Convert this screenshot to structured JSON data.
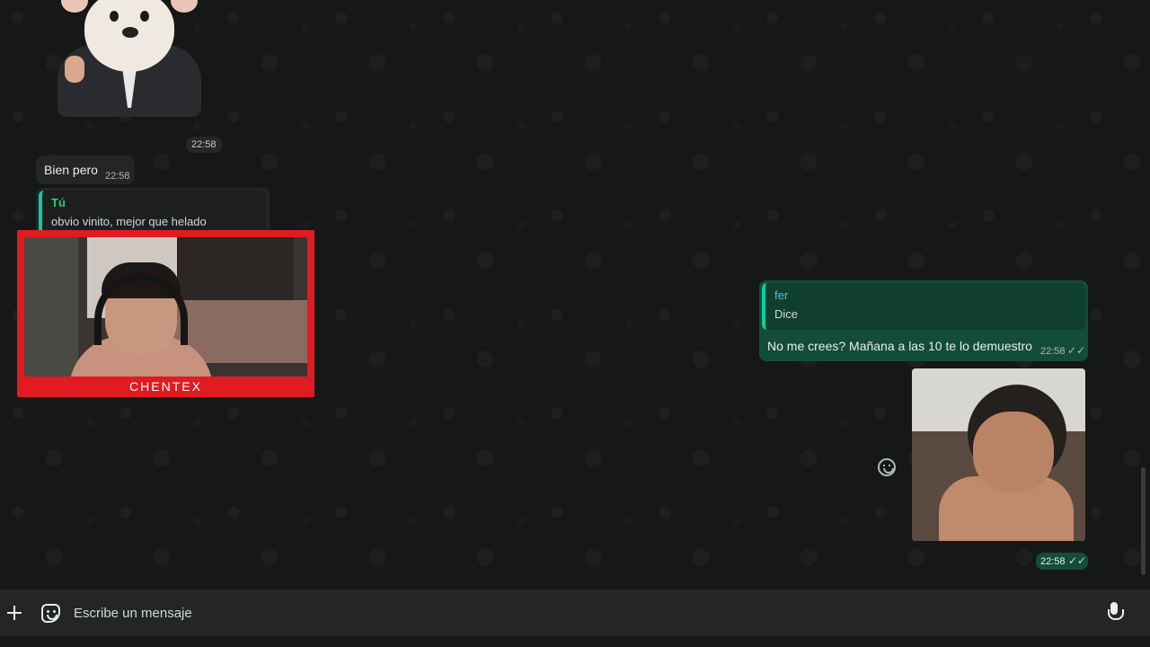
{
  "messages": {
    "sticker_time": "22:58",
    "incoming": {
      "text": "Bien pero",
      "time": "22:58"
    },
    "incoming_reply": {
      "quote_author": "Tú",
      "quote_text": "obvio vinito, mejor que helado"
    },
    "outgoing_reply": {
      "quote_author": "fer",
      "quote_text": "Dice",
      "text": "No me crees? Mañana a las 10 te lo demuestro",
      "time": "22:58",
      "ticks": "✓✓"
    },
    "outgoing_image": {
      "time": "22:58",
      "ticks": "✓✓"
    }
  },
  "webcam": {
    "label": "CHENTEX"
  },
  "composer": {
    "placeholder": "Escribe un mensaje"
  },
  "icons": {
    "attach": "plus-icon",
    "sticker": "sticker-icon",
    "mic": "mic-icon",
    "reaction": "emoji-icon"
  },
  "colors": {
    "background": "#161717",
    "incoming_bubble": "#242626",
    "outgoing_bubble": "#144d37",
    "webcam_frame": "#e01b22",
    "read_ticks": "#53bdeb"
  }
}
